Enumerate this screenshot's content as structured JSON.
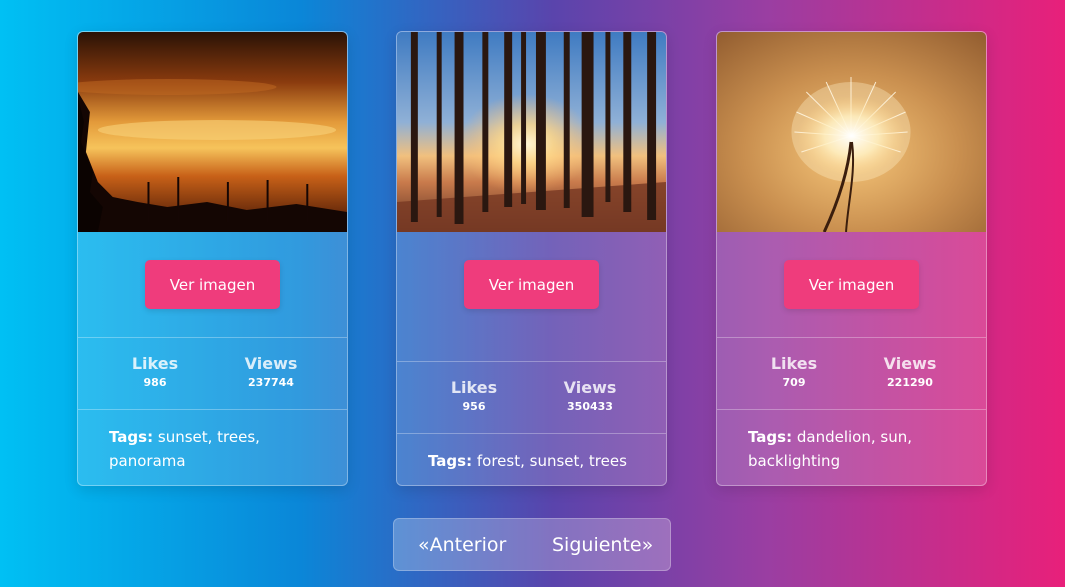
{
  "cards": [
    {
      "image_name": "sunset-trees-image",
      "button_label": "Ver imagen",
      "likes_label": "Likes",
      "likes_value": "986",
      "views_label": "Views",
      "views_value": "237744",
      "tags_label": "Tags:",
      "tags_value": "sunset, trees, panorama"
    },
    {
      "image_name": "forest-sunset-image",
      "button_label": "Ver imagen",
      "likes_label": "Likes",
      "likes_value": "956",
      "views_label": "Views",
      "views_value": "350433",
      "tags_label": "Tags:",
      "tags_value": "forest, sunset, trees"
    },
    {
      "image_name": "dandelion-sun-image",
      "button_label": "Ver imagen",
      "likes_label": "Likes",
      "likes_value": "709",
      "views_label": "Views",
      "views_value": "221290",
      "tags_label": "Tags:",
      "tags_value": "dandelion, sun, backlighting"
    }
  ],
  "pagination": {
    "prev_label": "«Anterior",
    "next_label": "Siguiente»"
  },
  "colors": {
    "button": "#ef3c7c",
    "background_start": "#00c0f4",
    "background_end": "#e8207a"
  }
}
